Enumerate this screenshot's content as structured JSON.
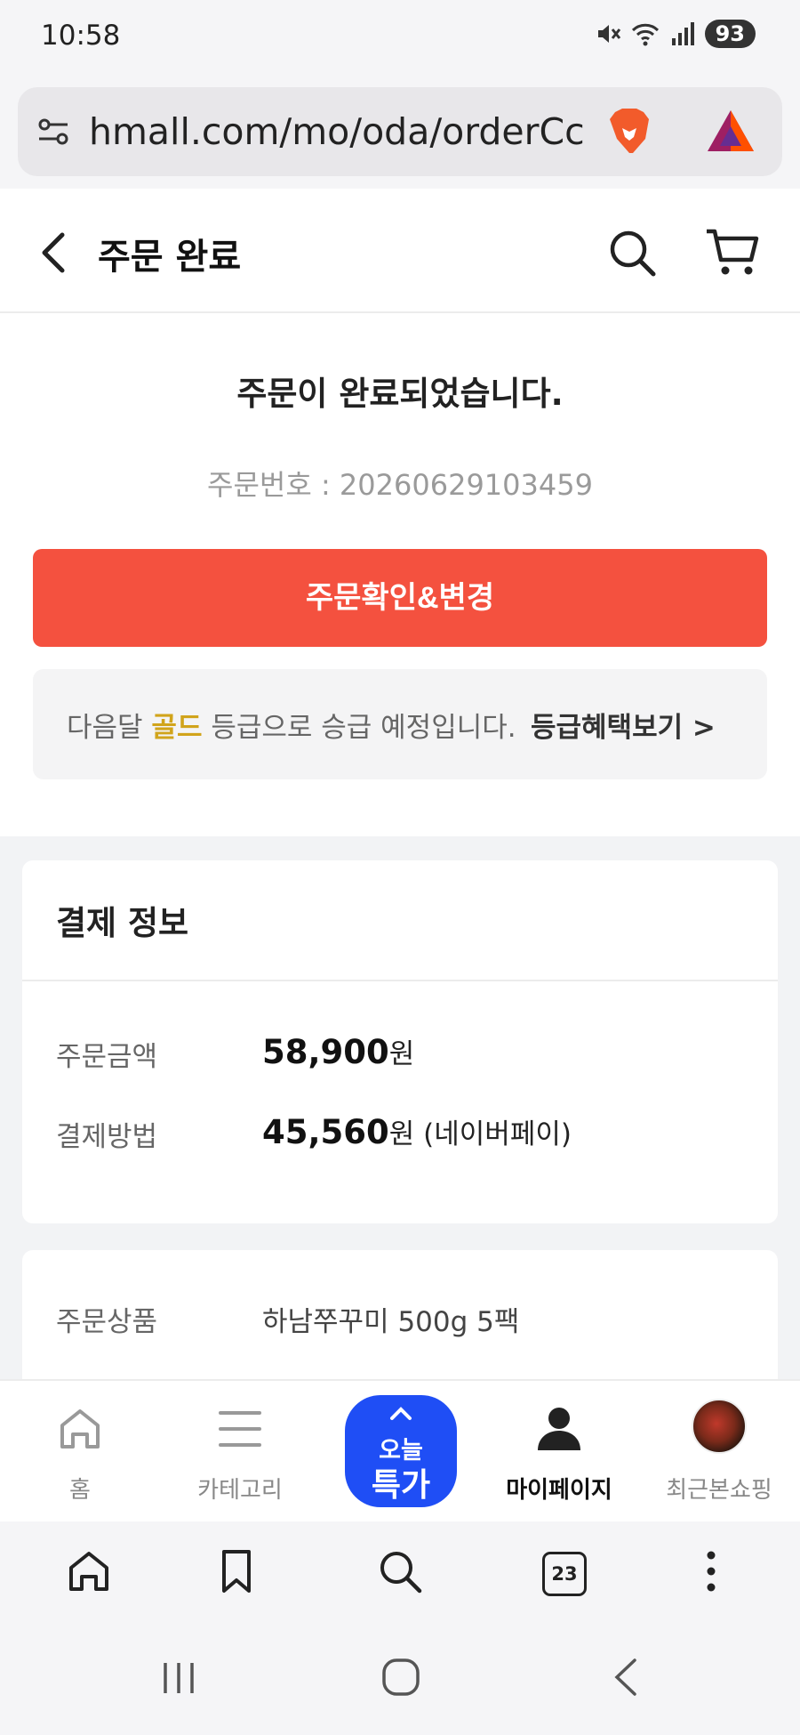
{
  "status_bar": {
    "time": "10:58",
    "battery": "93"
  },
  "browser": {
    "url": "hmall.com/mo/oda/orderCc",
    "tab_count": "23"
  },
  "header": {
    "title": "주문 완료"
  },
  "completion": {
    "title": "주문이 완료되었습니다.",
    "order_number_label": "주문번호 : ",
    "order_number": "20260629103459",
    "confirm_button": "주문확인&변경"
  },
  "grade_notice": {
    "prefix": "다음달 ",
    "grade": "골드",
    "suffix": " 등급으로 승급 예정입니다.",
    "link_label": "등급혜택보기",
    "link_arrow": ">"
  },
  "payment": {
    "title": "결제 정보",
    "rows": [
      {
        "label": "주문금액",
        "amount": "58,900",
        "unit": "원",
        "note": ""
      },
      {
        "label": "결제방법",
        "amount": "45,560",
        "unit": "원",
        "note": " (네이버페이)"
      }
    ]
  },
  "product": {
    "label": "주문상품",
    "value": "하남쭈꾸미 500g 5팩"
  },
  "app_nav": {
    "items": [
      {
        "label": "홈"
      },
      {
        "label": "카테고리"
      },
      {
        "label": "마이페이지"
      },
      {
        "label": "최근본쇼핑"
      }
    ],
    "today_line1": "오늘",
    "today_line2": "특가"
  },
  "colors": {
    "accent": "#f4513f",
    "gold": "#d1a41b",
    "today_blue": "#1f4ef5"
  }
}
